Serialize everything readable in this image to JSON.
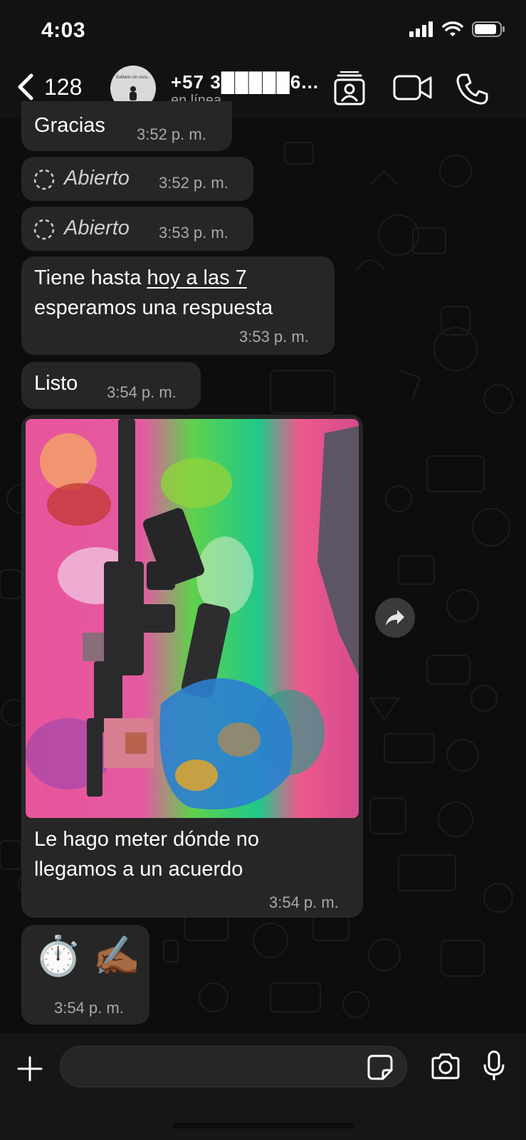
{
  "status_bar": {
    "time": "4:03"
  },
  "header": {
    "back_count": "128",
    "avatar_text": "Solitario sin cora...",
    "contact_name": "+57 3█████6...",
    "contact_status": "en línea"
  },
  "messages": [
    {
      "text": "Gracias",
      "time": "3:52 p. m."
    },
    {
      "text": "Abierto",
      "time": "3:52 p. m."
    },
    {
      "text": "Abierto",
      "time": "3:53 p. m."
    },
    {
      "text_line1_pre": "Tiene hasta ",
      "text_line1_link": "hoy a las 7",
      "text_line2": "esperamos una respuesta",
      "time": "3:53 p. m."
    },
    {
      "text": "Listo",
      "time": "3:54 p. m."
    },
    {
      "caption_line1": "Le hago meter dónde no",
      "caption_line2": "llegamos a un acuerdo",
      "time": "3:54 p. m."
    },
    {
      "emoji": "⏱️ ✍🏾",
      "time": "3:54 p. m."
    }
  ],
  "icons": {
    "back": "chevron-left-icon",
    "contact_card": "contact-card-icon",
    "video_call": "video-camera-icon",
    "voice_call": "phone-icon",
    "view_once": "view-once-icon",
    "forward": "forward-icon",
    "attach": "plus-icon",
    "sticker": "sticker-icon",
    "camera": "camera-icon",
    "mic": "microphone-icon"
  },
  "colors": {
    "background": "#0d0d0d",
    "bubble": "#262626",
    "timestamp": "#a9a9a9",
    "header": "#121212"
  }
}
